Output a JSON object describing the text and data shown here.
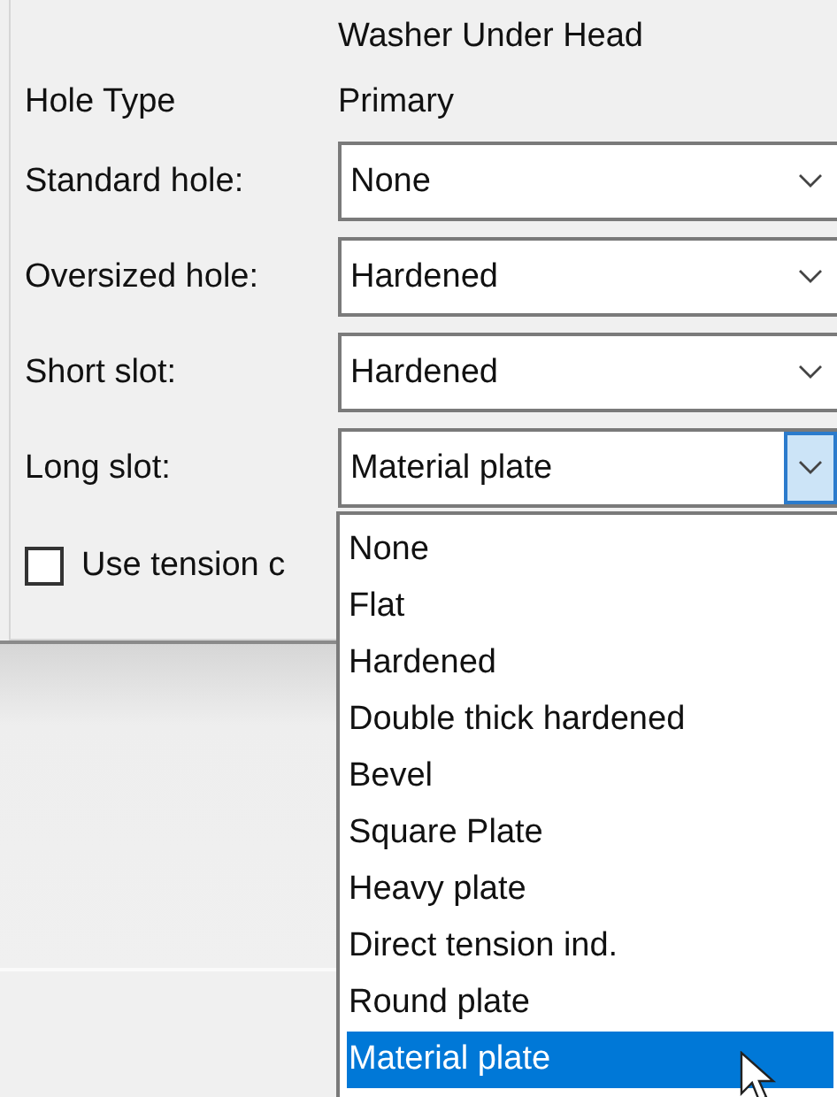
{
  "column_header": "Washer Under Head",
  "hole_type": {
    "label": "Hole Type",
    "value": "Primary"
  },
  "fields": [
    {
      "label": "Standard hole:",
      "value": "None",
      "open": false
    },
    {
      "label": "Oversized hole:",
      "value": "Hardened",
      "open": false
    },
    {
      "label": "Short slot:",
      "value": "Hardened",
      "open": false
    },
    {
      "label": "Long slot:",
      "value": "Material plate",
      "open": true
    }
  ],
  "checkbox": {
    "label": "Use tension c",
    "checked": false
  },
  "dropdown": {
    "options": [
      {
        "label": "None",
        "selected": false
      },
      {
        "label": "Flat",
        "selected": false
      },
      {
        "label": "Hardened",
        "selected": false
      },
      {
        "label": "Double thick hardened",
        "selected": false
      },
      {
        "label": "Bevel",
        "selected": false
      },
      {
        "label": "Square Plate",
        "selected": false
      },
      {
        "label": "Heavy plate",
        "selected": false
      },
      {
        "label": "Direct tension ind.",
        "selected": false
      },
      {
        "label": "Round plate",
        "selected": false
      },
      {
        "label": "Material plate",
        "selected": true
      }
    ]
  }
}
